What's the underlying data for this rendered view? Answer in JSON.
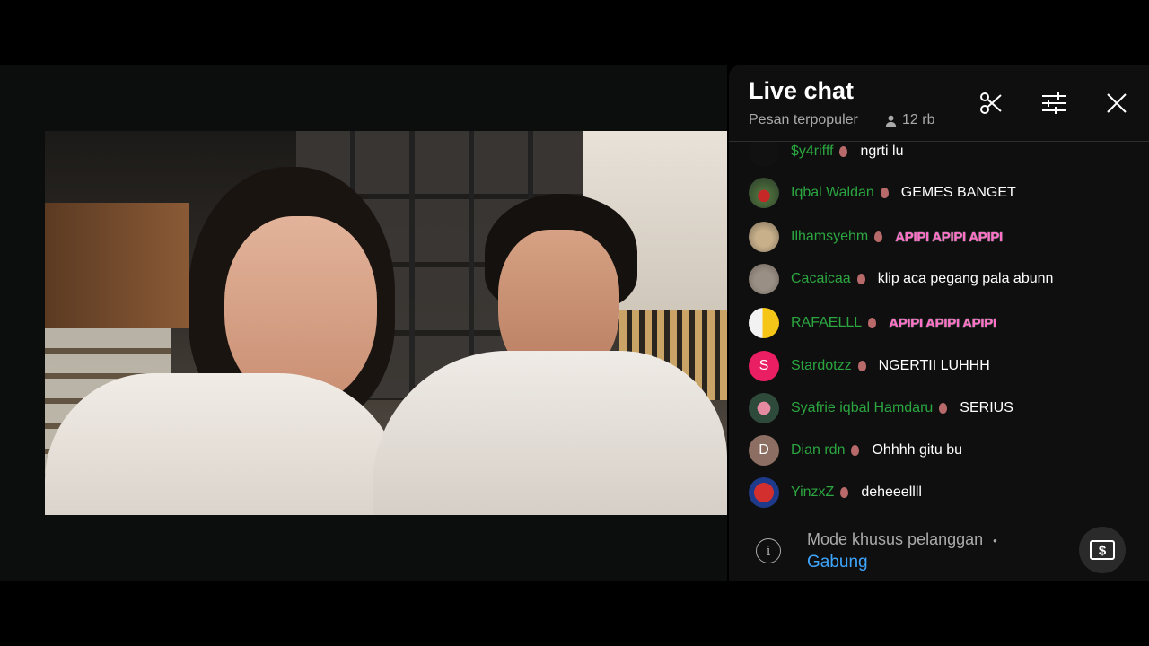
{
  "chat": {
    "title": "Live chat",
    "subtitle": "Pesan terpopuler",
    "viewers": "12 rb",
    "messages": [
      {
        "author": "$y4rifff",
        "text": "ngrti lu",
        "emote": false
      },
      {
        "author": "Iqbal Waldan",
        "text": "GEMES BANGET",
        "emote": false
      },
      {
        "author": "Ilhamsyehm",
        "text": "APIPI APIPI APIPI",
        "emote": true
      },
      {
        "author": "Cacaicaa",
        "text": "klip aca pegang pala abunn",
        "emote": false
      },
      {
        "author": "RAFAELLL",
        "text": "APIPI APIPI APIPI",
        "emote": true
      },
      {
        "author": "Stardotzz",
        "text": "NGERTII LUHHH",
        "emote": false,
        "initial": "S"
      },
      {
        "author": "Syafrie iqbal Hamdaru",
        "text": "SERIUS",
        "emote": false
      },
      {
        "author": "Dian rdn",
        "text": "Ohhhh gitu bu",
        "emote": false,
        "initial": "D"
      },
      {
        "author": "YinzxZ",
        "text": "deheeellll",
        "emote": false
      }
    ],
    "footer": {
      "mode_text": "Mode khusus pelanggan",
      "separator": "•",
      "join_label": "Gabung"
    }
  },
  "colors": {
    "author": "#2ba640",
    "link": "#3ea6ff",
    "chat_bg": "#0f0f0f"
  }
}
